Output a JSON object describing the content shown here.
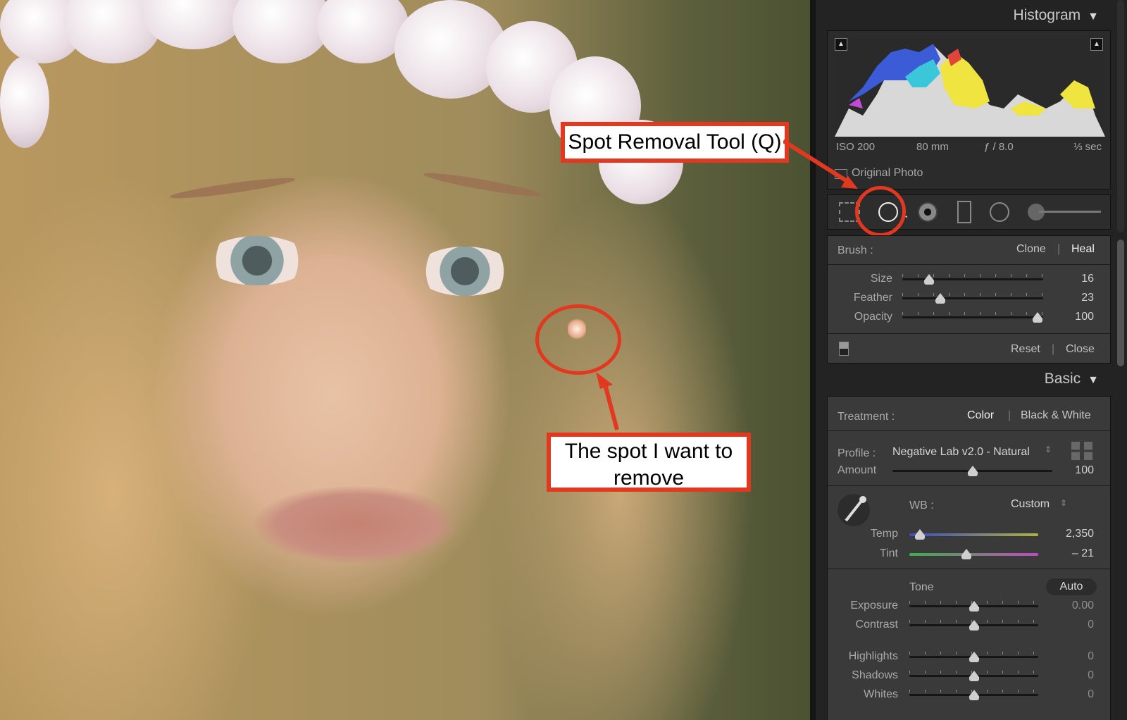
{
  "annotations": {
    "tool_callout": "Spot Removal Tool (Q)",
    "spot_callout_line1": "The spot I want to",
    "spot_callout_line2": "remove"
  },
  "histogram": {
    "title": "Histogram",
    "iso": "ISO 200",
    "focal": "80 mm",
    "aperture": "ƒ / 8.0",
    "shutter": "⅓ sec",
    "original_photo": "Original Photo"
  },
  "tools": [
    "crop-tool",
    "spot-removal-tool",
    "red-eye-tool",
    "graduated-filter-tool",
    "radial-filter-tool",
    "adjustment-brush-tool"
  ],
  "spot_panel": {
    "brush_label": "Brush :",
    "clone": "Clone",
    "heal": "Heal",
    "sliders": [
      {
        "label": "Size",
        "value": "16",
        "pos": 0.19
      },
      {
        "label": "Feather",
        "value": "23",
        "pos": 0.27
      },
      {
        "label": "Opacity",
        "value": "100",
        "pos": 0.96
      }
    ],
    "reset": "Reset",
    "close": "Close"
  },
  "basic": {
    "title": "Basic",
    "treatment_label": "Treatment :",
    "color": "Color",
    "bw": "Black & White",
    "profile_label": "Profile :",
    "profile_value": "Negative Lab v2.0 - Natural",
    "amount_label": "Amount",
    "amount_value": "100",
    "amount_pos": 0.5,
    "wb_label": "WB :",
    "wb_value": "Custom",
    "temp_label": "Temp",
    "temp_value": "2,350",
    "temp_pos": 0.08,
    "tint_label": "Tint",
    "tint_value": "– 21",
    "tint_pos": 0.44,
    "tone_label": "Tone",
    "auto": "Auto",
    "tone_sliders": [
      {
        "label": "Exposure",
        "value": "0.00",
        "pos": 0.5
      },
      {
        "label": "Contrast",
        "value": "0",
        "pos": 0.5
      },
      {
        "label": "Highlights",
        "value": "0",
        "pos": 0.5
      },
      {
        "label": "Shadows",
        "value": "0",
        "pos": 0.5
      },
      {
        "label": "Whites",
        "value": "0",
        "pos": 0.5
      }
    ]
  },
  "colors": {
    "annotation_red": "#e2381f",
    "panel_bg": "#3a3a3a"
  }
}
